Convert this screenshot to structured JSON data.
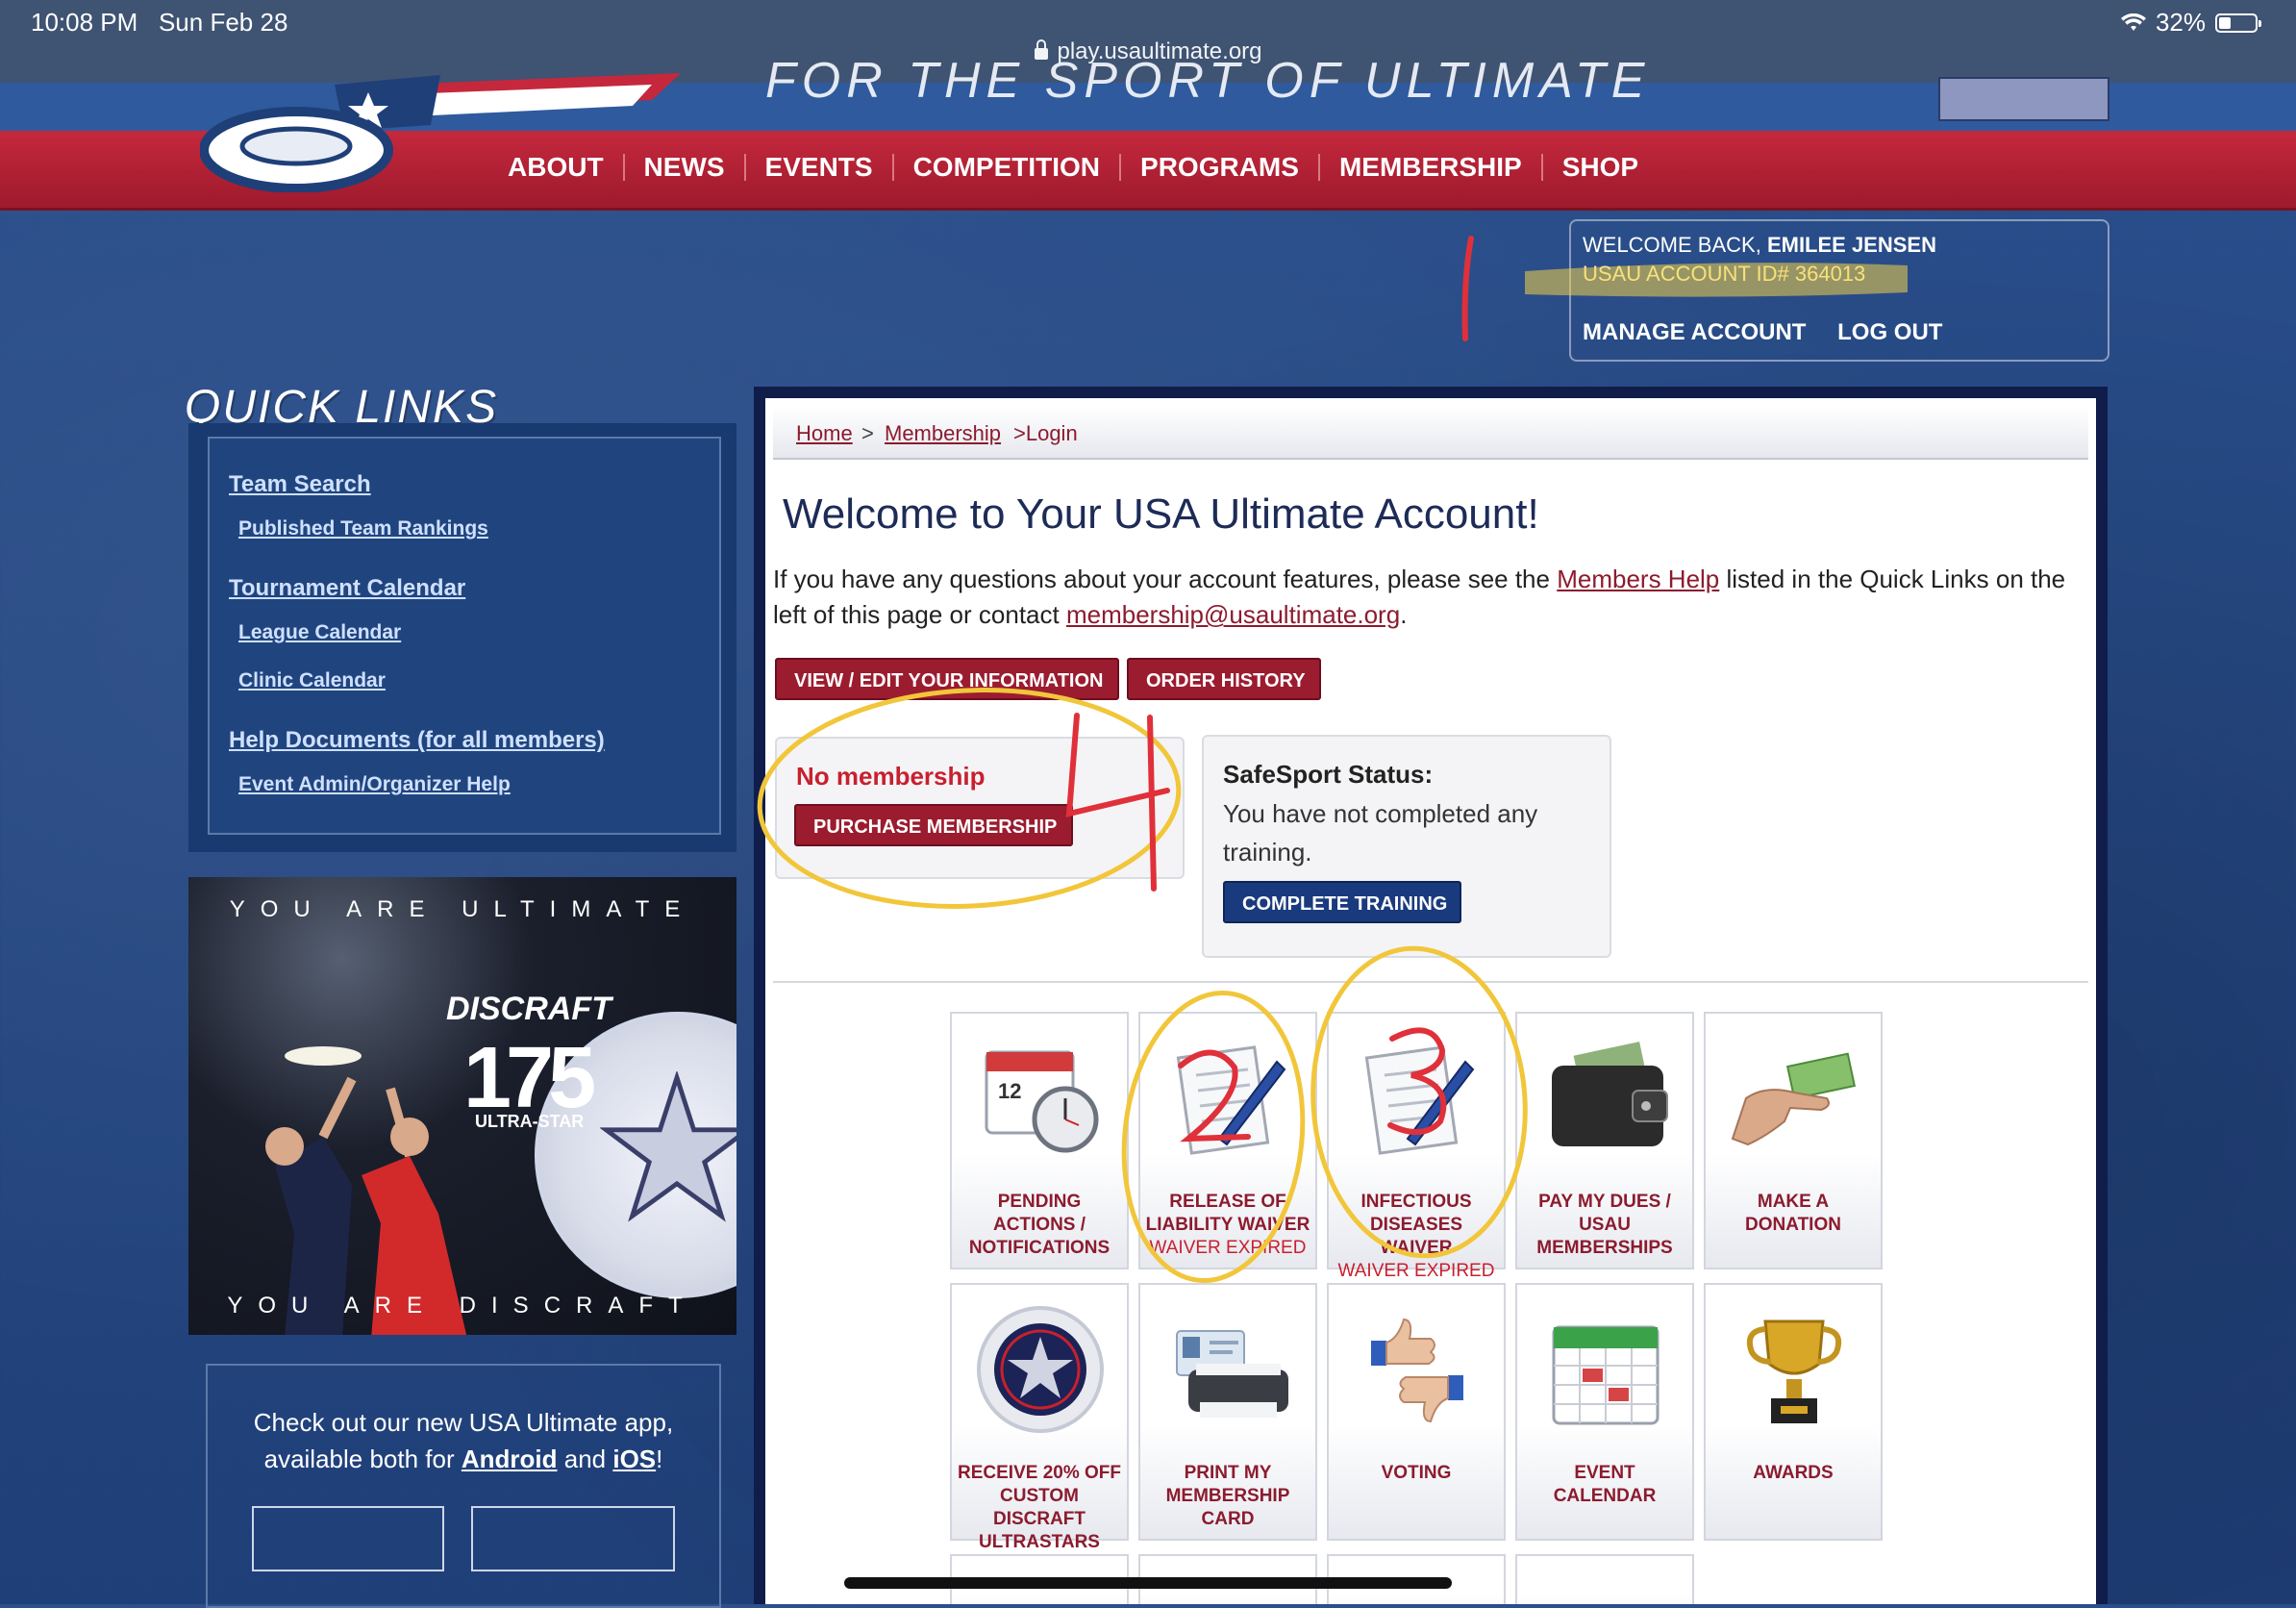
{
  "status_bar": {
    "time": "10:08 PM",
    "date": "Sun Feb 28",
    "url": "play.usaultimate.org",
    "battery": "32%",
    "battery_level": 0.32
  },
  "header": {
    "tagline": "FOR THE SPORT OF ULTIMATE"
  },
  "nav": {
    "items": [
      "ABOUT",
      "NEWS",
      "EVENTS",
      "COMPETITION",
      "PROGRAMS",
      "MEMBERSHIP",
      "SHOP"
    ]
  },
  "welcome_box": {
    "greeting": "WELCOME BACK,",
    "name": "EMILEE JENSEN",
    "account_id": "USAU ACCOUNT ID# 364013",
    "manage": "MANAGE ACCOUNT",
    "logout": "LOG OUT"
  },
  "quick_links": {
    "title": "QUICK LINKS",
    "items": [
      {
        "label": "Team Search",
        "level": "main"
      },
      {
        "label": "Published Team Rankings",
        "level": "sub"
      },
      {
        "label": "Tournament Calendar",
        "level": "main"
      },
      {
        "label": "League Calendar",
        "level": "sub"
      },
      {
        "label": "Clinic Calendar",
        "level": "sub"
      },
      {
        "label": "Help Documents (for all members)",
        "level": "main"
      },
      {
        "label": "Event Admin/Organizer Help",
        "level": "sub"
      }
    ]
  },
  "ad": {
    "top": "YOU ARE ULTIMATE",
    "brand": "DISCRAFT",
    "model": "175",
    "sub": "ULTRA-STAR",
    "bottom": "YOU ARE DISCRAFT"
  },
  "app_promo": {
    "text1": "Check out our new USA Ultimate app,",
    "text2_a": "available both for ",
    "android": "Android",
    "text2_b": " and ",
    "ios": "iOS",
    "text2_c": "!"
  },
  "breadcrumb": {
    "home": "Home",
    "sep1": ">",
    "membership": "Membership",
    "current": ">Login"
  },
  "main": {
    "title": "Welcome to Your USA Ultimate Account!",
    "intro_1": "If you have any questions about your account features, please see the ",
    "members_help": "Members Help",
    "intro_2": " listed in the Quick Links on the left of this page or contact ",
    "email": "membership@usaultimate.org",
    "intro_3": ".",
    "btn_view_edit": "VIEW / EDIT YOUR INFORMATION",
    "btn_order_history": "ORDER HISTORY"
  },
  "membership_card": {
    "status": "No membership",
    "button": "PURCHASE MEMBERSHIP"
  },
  "safesport_card": {
    "title": "SafeSport Status:",
    "text": "You have not completed any training.",
    "button": "COMPLETE TRAINING"
  },
  "tiles": [
    {
      "label": "PENDING ACTIONS / NOTIFICATIONS",
      "status": "",
      "icon": "calendar-stopwatch-icon"
    },
    {
      "label": "RELEASE OF LIABILITY WAIVER",
      "status": "WAIVER EXPIRED",
      "icon": "document-pen-icon"
    },
    {
      "label": "INFECTIOUS DISEASES WAIVER",
      "status": "WAIVER EXPIRED",
      "icon": "document-pen-icon"
    },
    {
      "label": "PAY MY DUES / USAU MEMBERSHIPS",
      "status": "",
      "icon": "wallet-icon"
    },
    {
      "label": "MAKE A DONATION",
      "status": "",
      "icon": "hand-money-icon"
    },
    {
      "label": "RECEIVE 20% OFF CUSTOM DISCRAFT ULTRASTARS",
      "status": "",
      "icon": "disc-icon"
    },
    {
      "label": "PRINT MY MEMBERSHIP CARD",
      "status": "",
      "icon": "printer-card-icon"
    },
    {
      "label": "VOTING",
      "status": "",
      "icon": "thumbs-up-down-icon"
    },
    {
      "label": "EVENT CALENDAR",
      "status": "",
      "icon": "calendar-icon"
    },
    {
      "label": "AWARDS",
      "status": "",
      "icon": "trophy-icon"
    }
  ],
  "annotations": {
    "mark1": "1",
    "mark2": "2",
    "mark3": "3",
    "mark4": "4"
  },
  "colors": {
    "nav_red": "#b22234",
    "navy": "#1a3a7e",
    "link_red": "#8c1b2e",
    "highlight": "#f2d24a",
    "ink_red": "#e0303a"
  }
}
